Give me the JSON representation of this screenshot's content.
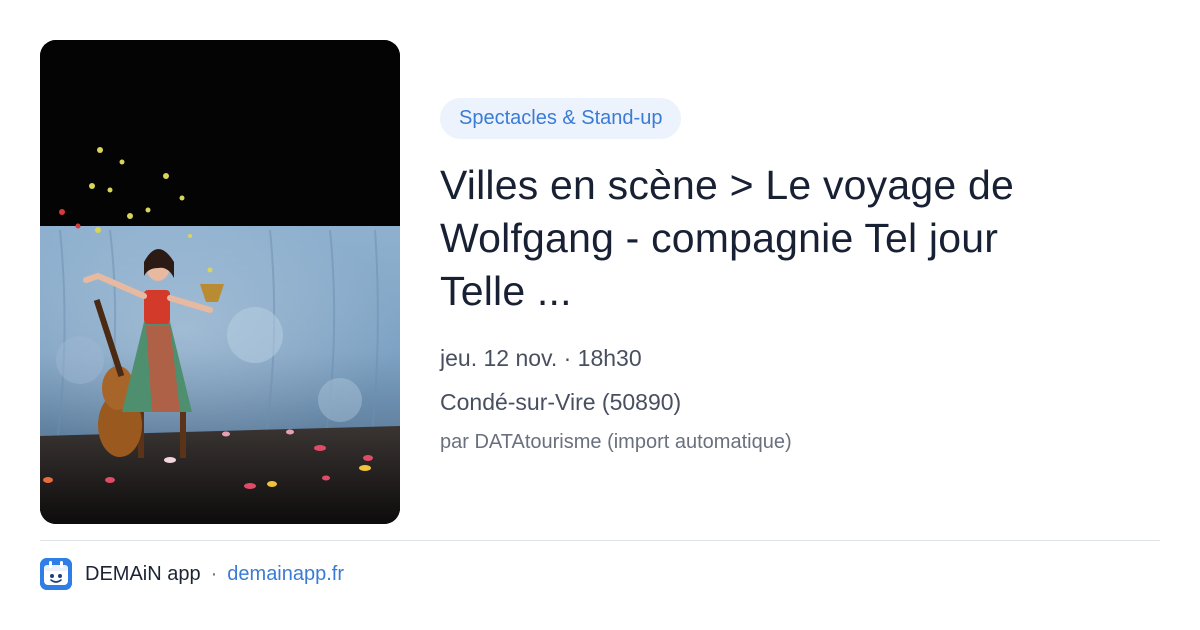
{
  "category": "Spectacles & Stand-up",
  "event": {
    "title": "Villes en scène > Le voyage de Wolfgang - compagnie Tel jour Telle ...",
    "datetime": "jeu. 12 nov. · 18h30",
    "location": "Condé-sur-Vire (50890)",
    "source": "par DATAtourisme (import automatique)",
    "image_icon": "stage-performance-photo"
  },
  "footer": {
    "app_icon": "app-logo-icon",
    "app_name": "DEMAiN app",
    "separator": "·",
    "url": "demainapp.fr"
  },
  "colors": {
    "accent": "#3a7bd5",
    "chip_bg": "#ecf3fc",
    "title": "#182033",
    "meta": "#485060",
    "muted": "#69707e",
    "divider": "#dde4ea"
  }
}
